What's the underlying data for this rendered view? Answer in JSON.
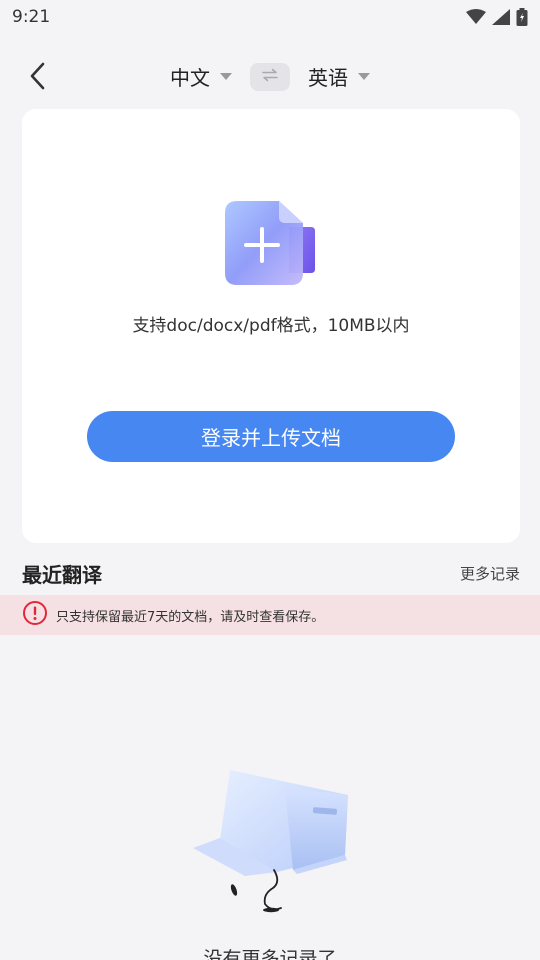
{
  "status_bar": {
    "time": "9:21",
    "icons": [
      "wifi-icon",
      "signal-icon",
      "battery-icon"
    ]
  },
  "header": {
    "back_icon": "chevron-left-icon",
    "source_language": "中文",
    "target_language": "英语",
    "swap_icon": "swap-arrows-icon"
  },
  "upload": {
    "icon": "document-add-icon",
    "hint": "支持doc/docx/pdf格式，10MB以内",
    "button_label": "登录并上传文档"
  },
  "recent": {
    "title": "最近翻译",
    "more_label": "更多记录",
    "notice_icon": "exclamation-circle-icon",
    "notice": "只支持保留最近7天的文档，请及时查看保存。",
    "empty_text": "没有更多记录了"
  },
  "colors": {
    "accent": "#4687f2",
    "notice_bg": "#f5e1e3",
    "notice_icon": "#e0283a",
    "page_bg": "#f4f4f6"
  }
}
